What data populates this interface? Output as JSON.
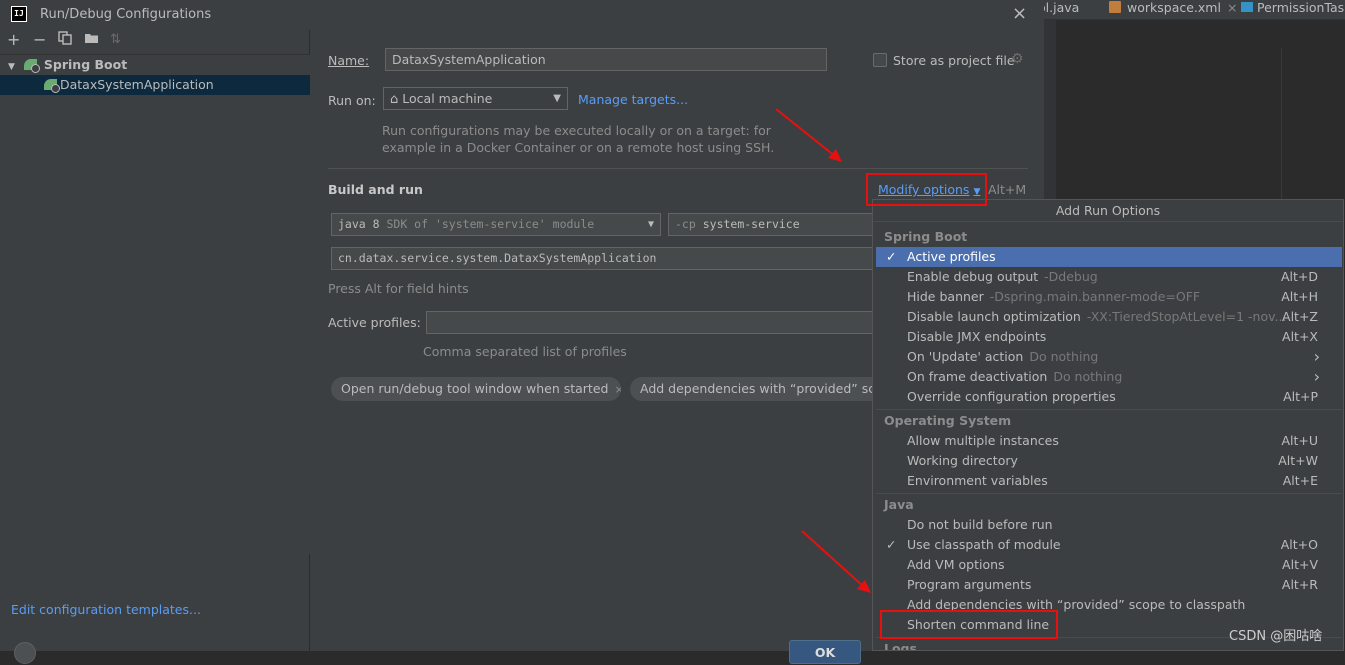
{
  "dialog": {
    "title": "Run/Debug Configurations",
    "app_icon": "IJ"
  },
  "ide": {
    "tabs": [
      {
        "label": "ol.java"
      },
      {
        "label": "workspace.xml"
      },
      {
        "label": "PermissionTas"
      }
    ]
  },
  "tree": {
    "group": "Spring Boot",
    "items": [
      "DataxSystemApplication"
    ]
  },
  "left_footer": {
    "edit_templates": "Edit configuration templates..."
  },
  "form": {
    "name_label": "Name:",
    "name_value": "DataxSystemApplication",
    "store_label": "Store as project file",
    "run_on_label": "Run on:",
    "run_on_value": "Local machine",
    "manage_targets": "Manage targets...",
    "run_hint_1": "Run configurations may be executed locally or on a target: for",
    "run_hint_2": "example in a Docker Container or on a remote host using SSH.",
    "build_run": "Build and run",
    "modify_options": "Modify options",
    "modify_shortcut": "Alt+M",
    "sdk_value": "java 8",
    "sdk_hint": "SDK of 'system-service' module",
    "cp_prefix": "-cp",
    "cp_value": "system-service",
    "main_class": "cn.datax.service.system.DataxSystemApplication",
    "alt_hint": "Press Alt for field hints",
    "active_profiles_label": "Active profiles:",
    "profiles_hint": "Comma separated list of profiles",
    "chip_1": "Open run/debug tool window when started",
    "chip_2": "Add dependencies with “provided” scope",
    "ok": "OK"
  },
  "popup": {
    "title": "Add Run Options",
    "groups": {
      "spring": "Spring Boot",
      "os": "Operating System",
      "java": "Java",
      "logs": "Logs"
    },
    "spring_items": [
      {
        "check": "✓",
        "name": "Active profiles",
        "sub": "",
        "sc": ""
      },
      {
        "check": "",
        "name": "Enable debug output",
        "sub": "-Ddebug",
        "sc": "Alt+D"
      },
      {
        "check": "",
        "name": "Hide banner",
        "sub": "-Dspring.main.banner-mode=OFF",
        "sc": "Alt+H"
      },
      {
        "check": "",
        "name": "Disable launch optimization",
        "sub": "-XX:TieredStopAtLevel=1 -nov...",
        "sc": "Alt+Z"
      },
      {
        "check": "",
        "name": "Disable JMX endpoints",
        "sub": "",
        "sc": "Alt+X"
      },
      {
        "check": "",
        "name": "On 'Update' action",
        "sub": "Do nothing",
        "sc": "›"
      },
      {
        "check": "",
        "name": "On frame deactivation",
        "sub": "Do nothing",
        "sc": "›"
      },
      {
        "check": "",
        "name": "Override configuration properties",
        "sub": "",
        "sc": "Alt+P"
      }
    ],
    "os_items": [
      {
        "name": "Allow multiple instances",
        "sc": "Alt+U"
      },
      {
        "name": "Working directory",
        "sc": "Alt+W"
      },
      {
        "name": "Environment variables",
        "sc": "Alt+E"
      }
    ],
    "java_items": [
      {
        "check": "",
        "name": "Do not build before run",
        "sc": ""
      },
      {
        "check": "✓",
        "name": "Use classpath of module",
        "sc": "Alt+O"
      },
      {
        "check": "",
        "name": "Add VM options",
        "sc": "Alt+V"
      },
      {
        "check": "",
        "name": "Program arguments",
        "sc": "Alt+R"
      },
      {
        "check": "",
        "name": "Add dependencies with “provided” scope to classpath",
        "sc": ""
      },
      {
        "check": "",
        "name": "Shorten command line",
        "sc": ""
      }
    ]
  },
  "watermark": "CSDN @困咕啥",
  "colors": {
    "accent_link": "#589df6",
    "selection": "#4b6eaf",
    "annotation_red": "#e8100e"
  }
}
